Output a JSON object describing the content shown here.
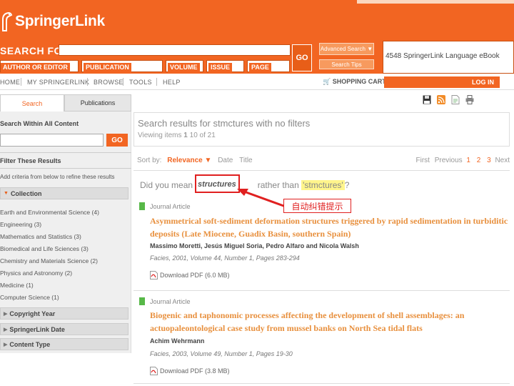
{
  "colors": {
    "brand": "#f26522",
    "annotation_red": "#e02020",
    "result_title": "#e8903e",
    "green_marker": "#57b848"
  },
  "header": {
    "logo_text": "SpringerLink",
    "search_label": "SEARCH FOR",
    "fields": {
      "author": "AUTHOR OR EDITOR",
      "publication": "PUBLICATION",
      "volume": "VOLUME",
      "issue": "ISSUE",
      "page": "PAGE"
    },
    "go_label": "GO",
    "advanced_search": "Advanced Search ▼",
    "search_tips": "Search Tips",
    "ebook_promo": "4548 SpringerLink Language eBook"
  },
  "nav": {
    "items": [
      "HOME",
      "MY SPRINGERLINK",
      "BROWSE",
      "TOOLS",
      "HELP"
    ],
    "cart": "SHOPPING CART",
    "login": "LOG IN"
  },
  "sidebar": {
    "tabs": {
      "search": "Search",
      "publications": "Publications"
    },
    "search_within": "Search Within All Content",
    "go_label": "GO",
    "filter_heading": "Filter These Results",
    "refine_note": "Add criteria from below to refine these results",
    "collection_label": "Collection",
    "collection_items": [
      "Earth and Environmental Science (4)",
      "Engineering (3)",
      "Mathematics and Statistics (3)",
      "Biomedical and Life Sciences (3)",
      "Chemistry and Materials Science (2)",
      "Physics and Astronomy (2)",
      "Medicine (1)",
      "Computer Science (1)"
    ],
    "copyright_label": "Copyright Year",
    "date_label": "SpringerLink Date",
    "content_type_label": "Content Type"
  },
  "results": {
    "title": "Search results for stmctures with no filters",
    "viewing_prefix": "Viewing items",
    "viewing_start": "1",
    "viewing_range": "10 of 21",
    "sort_by": "Sort by:",
    "sort_relevance": "Relevance ▼",
    "sort_date": "Date",
    "sort_title": "Title",
    "pager_first": "First",
    "pager_previous": "Previous",
    "pages": [
      "1",
      "2",
      "3"
    ],
    "pager_next": "Next"
  },
  "did_you_mean": {
    "prefix": "Did you mean",
    "suggestion": "structures",
    "middle": "rather than",
    "original": "'stmctures'",
    "suffix": "?",
    "annotation": "自动纠错提示"
  },
  "items": [
    {
      "type": "Journal Article",
      "title": "Asymmetrical soft-sediment deformation structures triggered by rapid sedimentation in turbiditic deposits (Late Miocene, Guadix Basin, southern Spain)",
      "authors": "Massimo Moretti, Jesús Miguel Soria, Pedro Alfaro and Nicola Walsh",
      "journal": "Facies, 2001, Volume 44, Number 1, Pages 283-294",
      "pdf": "Download PDF (6.0 MB)"
    },
    {
      "type": "Journal Article",
      "title": "Biogenic and taphonomic processes affecting the development of shell assemblages: an actuopaleontological case study from mussel banks on North Sea tidal flats",
      "authors": "Achim Wehrmann",
      "journal": "Facies, 2003, Volume 49, Number 1, Pages 19-30",
      "pdf": "Download PDF (3.8 MB)"
    }
  ]
}
